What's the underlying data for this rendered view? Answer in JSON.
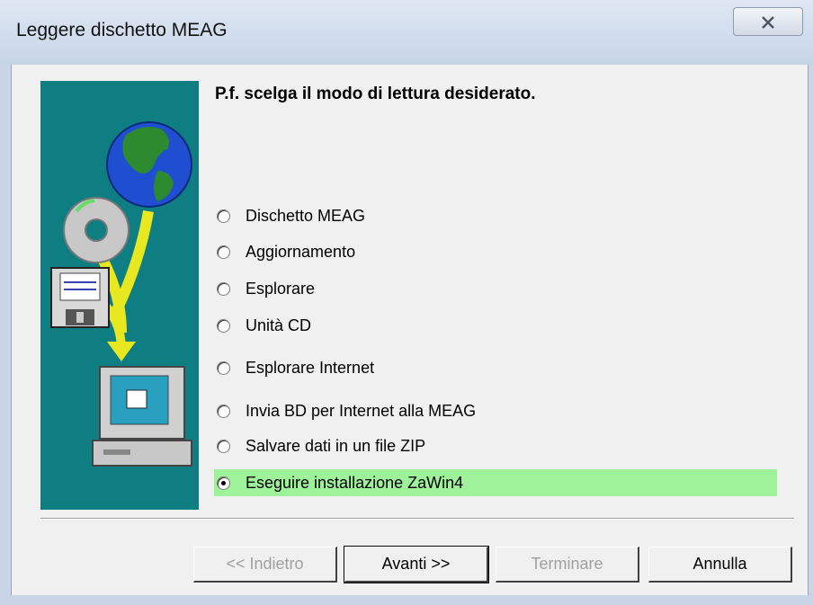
{
  "window": {
    "title": "Leggere dischetto MEAG",
    "close_icon": "close-x-icon"
  },
  "dialog": {
    "heading": "P.f. scelga il modo di lettura desiderato.",
    "options": [
      {
        "label": "Dischetto MEAG",
        "selected": false
      },
      {
        "label": "Aggiornamento",
        "selected": false
      },
      {
        "label": "Esplorare",
        "selected": false
      },
      {
        "label": "Unità CD",
        "selected": false
      },
      {
        "label": "Esplorare Internet",
        "selected": false
      },
      {
        "label": "Invia BD per Internet alla MEAG",
        "selected": false
      },
      {
        "label": "Salvare dati in un file ZIP",
        "selected": false
      },
      {
        "label": "Eseguire installazione ZaWin4",
        "selected": true
      }
    ],
    "highlight_color": "#9ef29a",
    "side_panel_color": "#0e7e82"
  },
  "buttons": {
    "back": "<< Indietro",
    "next": "Avanti >>",
    "finish": "Terminare",
    "cancel": "Annulla"
  }
}
